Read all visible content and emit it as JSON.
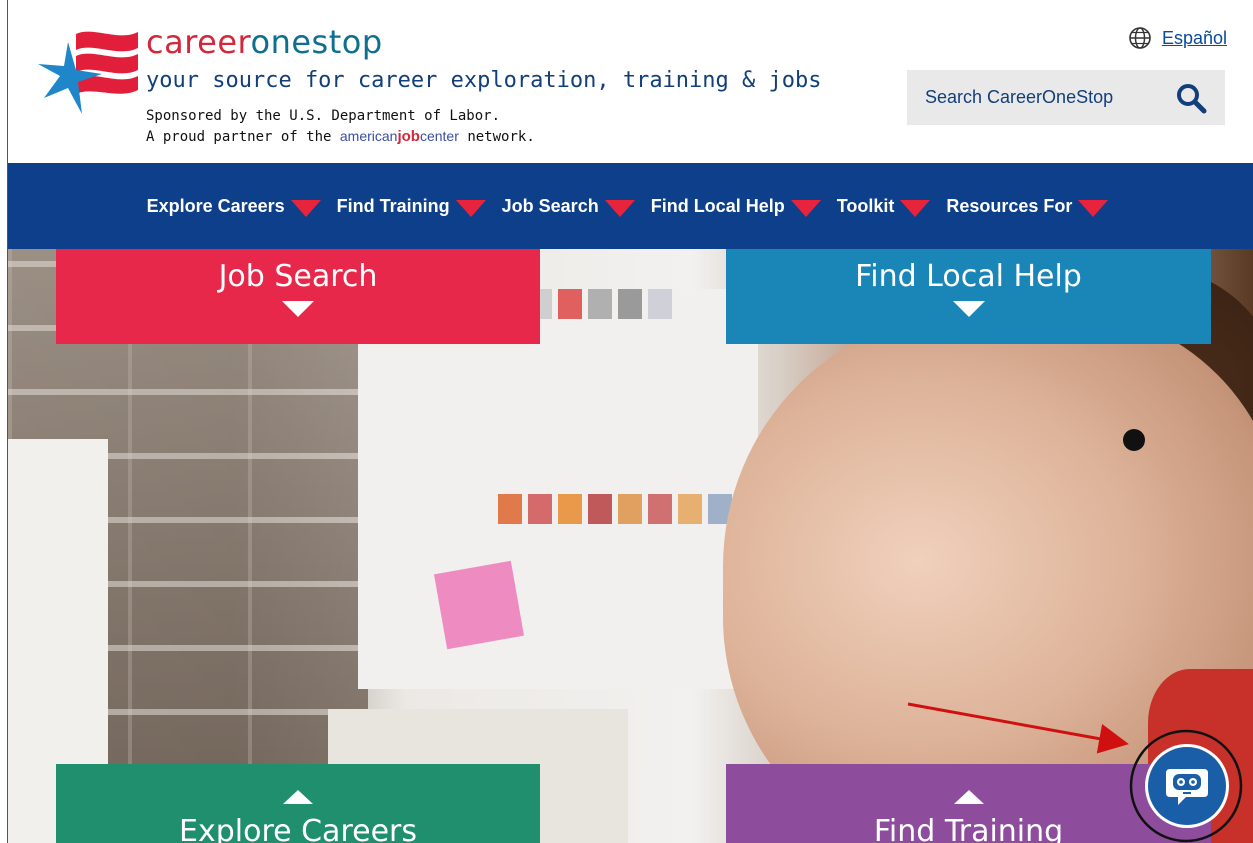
{
  "header": {
    "brand_career": "career",
    "brand_onestop": "onestop",
    "tagline": "your source for career exploration, training & jobs",
    "sponsor_line": "Sponsored by the U.S. Department of Labor.",
    "partner_prefix": "A proud partner of the ",
    "partner_ajc_a": "american",
    "partner_ajc_b": "job",
    "partner_ajc_c": "center",
    "partner_suffix": " network.",
    "language_link": "Español",
    "search_label": "Search CareerOneStop"
  },
  "nav": {
    "items": [
      {
        "label": "Explore Careers"
      },
      {
        "label": "Find Training"
      },
      {
        "label": "Job Search"
      },
      {
        "label": "Find Local Help"
      },
      {
        "label": "Toolkit"
      },
      {
        "label": "Resources For"
      }
    ]
  },
  "tiles": {
    "job_search": "Job Search",
    "find_local_help": "Find Local Help",
    "explore_careers": "Explore Careers",
    "find_training": "Find Training"
  },
  "colors": {
    "nav_bg": "#0d3f8a",
    "accent_red": "#e8243c",
    "tile_job": "#e8284a",
    "tile_local": "#1a86b8",
    "tile_explore": "#1f8f6e",
    "tile_train": "#8e4d9c",
    "chat_bg": "#1a5ea8",
    "annotation_arrow": "#d01010"
  },
  "icons": {
    "globe": "globe-icon",
    "search": "search-icon",
    "chat": "chatbot-icon",
    "logo": "careeronestop-flag-star-logo"
  }
}
